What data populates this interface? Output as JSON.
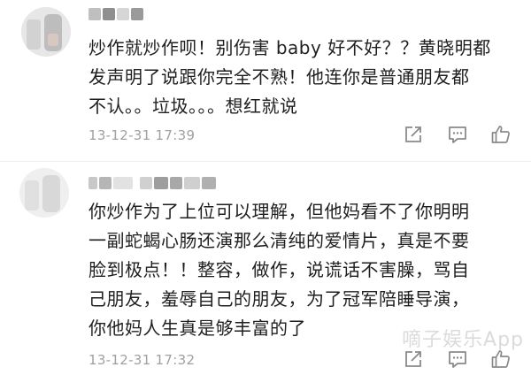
{
  "comments": [
    {
      "lines": [
        "炒作就炒作呗！别伤害 baby 好不好？？黄晓明都",
        "发声明了说跟你完全不熟！他连你是普通朋友都",
        "不认。。垃圾。。。想红就说"
      ],
      "timestamp": "13-12-31 17:39",
      "icons": [
        "share-icon",
        "reply-icon",
        "like-icon"
      ]
    },
    {
      "lines": [
        "你炒作为了上位可以理解，但他妈看不了你明明",
        "一副蛇蝎心肠还演那么清纯的爱情片，真是不要",
        "脸到极点！！整容，做作，说谎话不害臊，骂自",
        "己朋友，羞辱自己的朋友，为了冠军陪睡导演，",
        "你他妈人生真是够丰富的了"
      ],
      "timestamp": "13-12-31 17:32",
      "icons": [
        "share-icon",
        "reply-icon",
        "like-icon"
      ]
    }
  ],
  "watermark": "嘀子娱乐App",
  "colors": {
    "text": "#1f1f1f",
    "meta": "#a0a0a0",
    "icon": "#8a8a8a",
    "divider": "#ededed"
  }
}
